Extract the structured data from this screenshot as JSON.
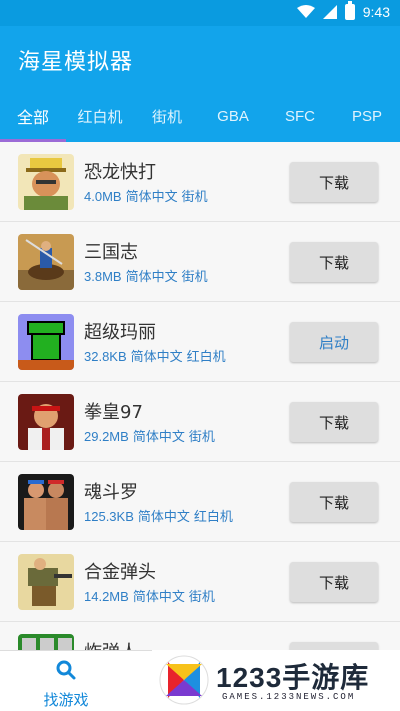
{
  "status_bar": {
    "time": "9:43"
  },
  "app": {
    "title": "海星模拟器"
  },
  "tabs": [
    {
      "label": "全部",
      "active": true
    },
    {
      "label": "红白机",
      "active": false
    },
    {
      "label": "街机",
      "active": false
    },
    {
      "label": "GBA",
      "active": false
    },
    {
      "label": "SFC",
      "active": false
    },
    {
      "label": "PSP",
      "active": false
    }
  ],
  "games": [
    {
      "name": "恐龙快打",
      "size": "4.0MB",
      "lang": "简体中文",
      "platform": "街机",
      "action": "下载",
      "thumb": "soldier-cap-art"
    },
    {
      "name": "三国志",
      "size": "3.8MB",
      "lang": "简体中文",
      "platform": "街机",
      "action": "下载",
      "thumb": "horseman-art"
    },
    {
      "name": "超级玛丽",
      "size": "32.8KB",
      "lang": "简体中文",
      "platform": "红白机",
      "action": "启动",
      "thumb": "green-pipe-art"
    },
    {
      "name": "拳皇97",
      "size": "29.2MB",
      "lang": "简体中文",
      "platform": "街机",
      "action": "下载",
      "thumb": "fighter-art"
    },
    {
      "name": "魂斗罗",
      "size": "125.3KB",
      "lang": "简体中文",
      "platform": "红白机",
      "action": "下载",
      "thumb": "commandos-art"
    },
    {
      "name": "合金弹头",
      "size": "14.2MB",
      "lang": "简体中文",
      "platform": "街机",
      "action": "下载",
      "thumb": "metal-slug-art"
    },
    {
      "name": "炸弹人",
      "size": "",
      "lang": "",
      "platform": "",
      "action": "",
      "thumb": "bomberman-art"
    }
  ],
  "bottom_nav": {
    "find_label": "找游戏"
  },
  "watermark": {
    "brand": "1233手游库",
    "domain": "GAMES.1233NEWS.COM"
  },
  "colors": {
    "header": "#12a4eb",
    "accent": "#2f7fc6",
    "tab_indicator": "#9b6bd6"
  }
}
